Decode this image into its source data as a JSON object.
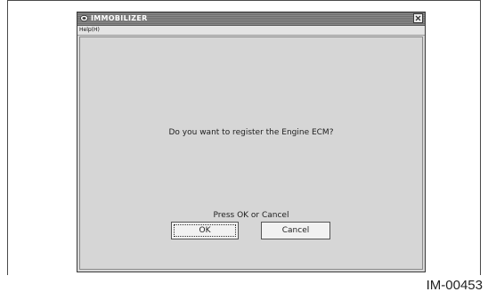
{
  "window": {
    "title": "IMMOBILIZER",
    "icons": {
      "app": "app-logo-icon",
      "close": "close-icon"
    }
  },
  "menu": {
    "help_label": "Help(H)"
  },
  "dialog": {
    "question": "Do you want to register the Engine ECM?",
    "instruction": "Press OK or Cancel",
    "ok_label": "OK",
    "cancel_label": "Cancel"
  },
  "figure": {
    "code": "IM-00453"
  }
}
